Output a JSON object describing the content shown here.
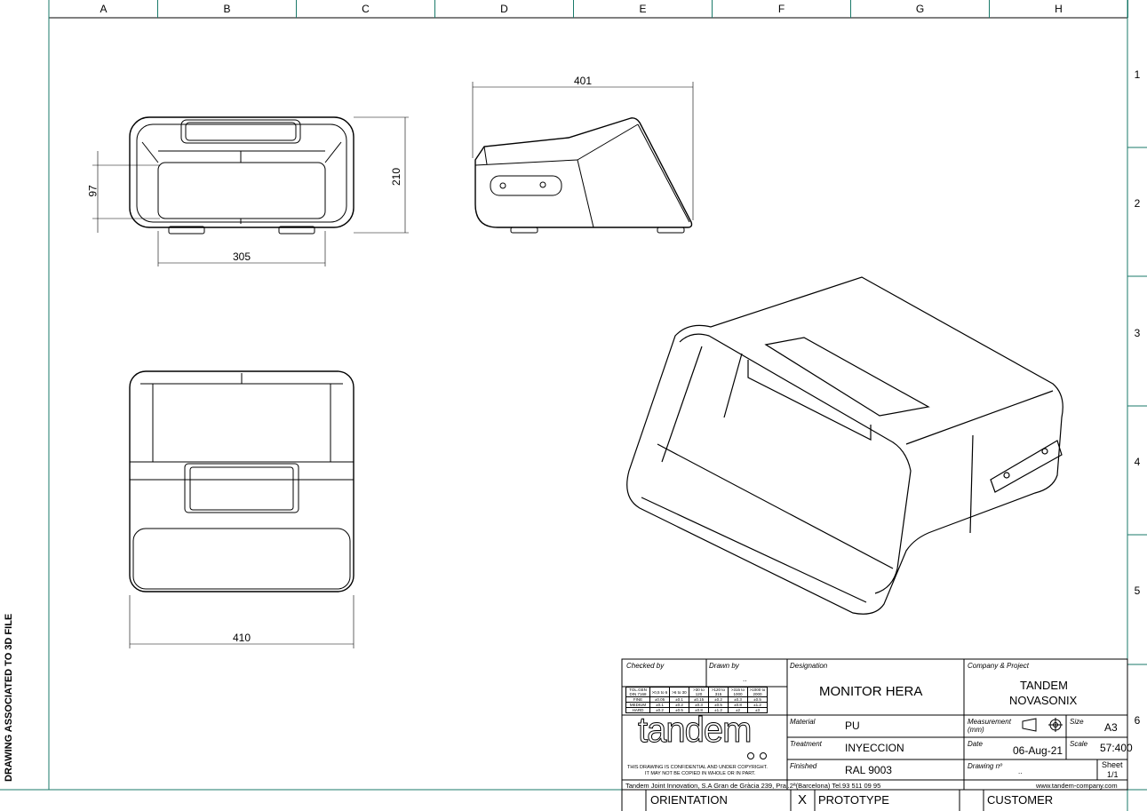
{
  "columns": [
    "A",
    "B",
    "C",
    "D",
    "E",
    "F",
    "G",
    "H"
  ],
  "rows": [
    "1",
    "2",
    "3",
    "4",
    "5",
    "6"
  ],
  "side_label": "DRAWING ASSOCIATED TO 3D FILE",
  "dimensions": {
    "front_height_inner": "97",
    "front_height": "210",
    "front_width": "305",
    "side_length": "401",
    "top_width": "410"
  },
  "title_block": {
    "checked_by_label": "Checked by",
    "drawn_by_label": "Drawn by",
    "drawn_by_value": "..",
    "designation_label": "Designation",
    "designation": "MONITOR HERA",
    "company_label": "Company & Project",
    "company_line1": "TANDEM",
    "company_line2": "NOVASONIX",
    "material_label": "Material",
    "material": "PU",
    "measurement_label": "Measurement (mm)",
    "size_label": "Size",
    "size": "A3",
    "treatment_label": "Treatment",
    "treatment": "INYECCION",
    "date_label": "Date",
    "date": "06-Aug-21",
    "scale_label": "Scale",
    "scale": "57:400",
    "finished_label": "Finished",
    "finished": "RAL 9003",
    "drawing_no_label": "Drawing nº",
    "drawing_no": "..",
    "sheet_label": "Sheet",
    "sheet": "1/1",
    "logo": "tandem",
    "confidential_line1": "THIS DRAWING IS CONFIDENTIAL AND UNDER COPYRIGHT.",
    "confidential_line2": "IT MAY NOT BE COPIED IN WHOLE OR IN PART.",
    "footer_left": "Tandem Joint Innovation, S.A   Gran de Gràcia 239, Pral.2ª(Barcelona)   Tel.93 511 09 95",
    "footer_right": "www.tandem-company.com"
  },
  "tolerance_table": {
    "headers": [
      "TOL.GEN DIN 7168",
      ">0,5 to 6",
      ">6 to 30",
      ">30 to 120",
      ">120 to 315",
      ">315 to 1000",
      ">1000 to 2000"
    ],
    "rows": [
      [
        "FINE",
        "±0.05",
        "±0.1",
        "±0.15",
        "±0.2",
        "±0.3",
        "±0.5"
      ],
      [
        "MEDIUM",
        "±0.1",
        "±0.2",
        "±0.3",
        "±0.5",
        "±0.8",
        "±1.2"
      ],
      [
        "HARD",
        "±0.2",
        "±0.5",
        "±0.8",
        "±1.2",
        "±2",
        "±3"
      ]
    ]
  },
  "bottom_bar": {
    "orientation": "ORIENTATION",
    "mark": "X",
    "prototype": "PROTOTYPE",
    "customer": "CUSTOMER"
  }
}
